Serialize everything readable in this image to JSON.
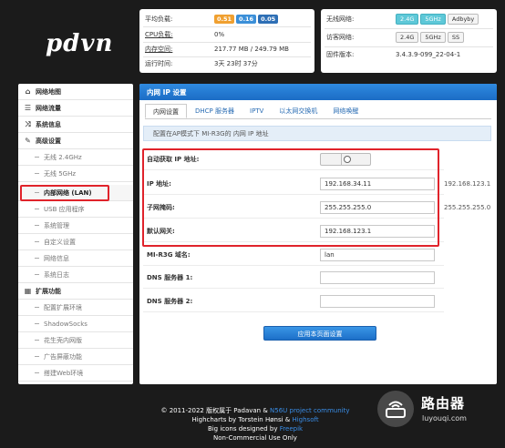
{
  "logo": "pdvn",
  "status_left": {
    "rows": [
      {
        "label": "平均负载:",
        "badges": [
          "0.51",
          "0.16",
          "0.05"
        ]
      },
      {
        "label": "CPU负载:",
        "value": "0%"
      },
      {
        "label": "内存空间:",
        "value": "217.77 MB / 249.79 MB"
      },
      {
        "label": "运行时间:",
        "value": "3天 23时 37分"
      }
    ]
  },
  "status_right": {
    "rows": [
      {
        "label": "无线网络:",
        "pills": [
          "2.4G",
          "5GHz",
          "Adbyby"
        ]
      },
      {
        "label": "访客网络:",
        "pills": [
          "2.4G",
          "5GHz",
          "SS"
        ]
      },
      {
        "label": "固件版本:",
        "value": "3.4.3.9-099_22-04-1"
      }
    ]
  },
  "sidebar": {
    "items": [
      {
        "label": "网络地图",
        "icon": "home-icon"
      },
      {
        "label": "网络流量",
        "icon": "list-icon"
      },
      {
        "label": "系统信息",
        "icon": "shuffle-icon"
      },
      {
        "label": "高级设置",
        "icon": "wrench-icon"
      },
      {
        "label": "无线 2.4GHz"
      },
      {
        "label": "无线 5GHz"
      },
      {
        "label": "内部网络 (LAN)"
      },
      {
        "label": "USB 应用程序"
      },
      {
        "label": "系统管理"
      },
      {
        "label": "自定义设置"
      },
      {
        "label": "网络信息"
      },
      {
        "label": "系统日志"
      },
      {
        "label": "扩展功能",
        "icon": "grid-icon"
      },
      {
        "label": "配置扩展环境"
      },
      {
        "label": "ShadowSocks"
      },
      {
        "label": "花生壳内网版"
      },
      {
        "label": "广告屏蔽功能"
      },
      {
        "label": "搭建Web环境"
      }
    ]
  },
  "main": {
    "title": "内网 IP 设置",
    "tabs": [
      "内网设置",
      "DHCP 服务器",
      "IPTV",
      "以太网交换机",
      "网络唤醒"
    ],
    "notice": "配置在AP模式下 MI-R3G的 内网 IP 地址",
    "fields": [
      {
        "label": "自动获取 IP 地址:"
      },
      {
        "label": "IP 地址:",
        "value": "192.168.34.11",
        "hint": "192.168.123.1"
      },
      {
        "label": "子网掩码:",
        "value": "255.255.255.0",
        "hint": "255.255.255.0"
      },
      {
        "label": "默认网关:",
        "value": "192.168.123.1"
      },
      {
        "label": "MI-R3G 域名:",
        "value": "lan"
      },
      {
        "label": "DNS 服务器 1:",
        "value": ""
      },
      {
        "label": "DNS 服务器 2:",
        "value": ""
      }
    ],
    "apply_label": "应用本页面设置"
  },
  "footer": {
    "line1_prefix": "© 2011-2022 版权属于 Padavan &",
    "line1_link": "N56U project community",
    "line2_prefix": "Highcharts by Torstein Hønsi &",
    "line2_link": "Highsoft",
    "line3_prefix": "Big icons designed by",
    "line3_link": "Freepik",
    "line4": "Non-Commercial Use Only"
  },
  "watermark": {
    "title": "路由器",
    "url": "luyouqi.com"
  },
  "colors": {
    "accent": "#1b6cc5",
    "highlight": "#e0232b"
  }
}
